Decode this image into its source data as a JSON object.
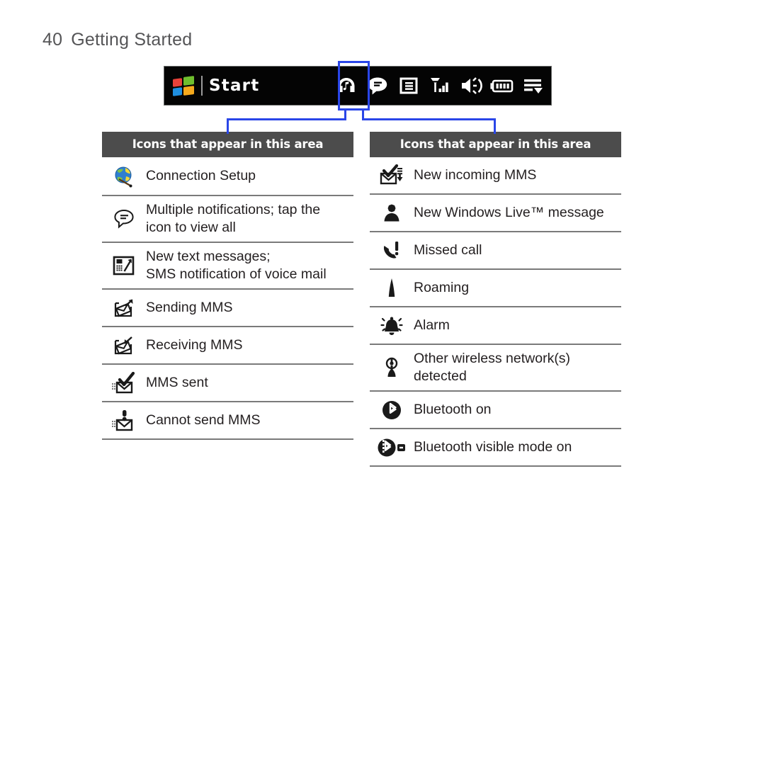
{
  "page": {
    "number": "40",
    "section_title": "Getting Started"
  },
  "taskbar": {
    "start_label": "Start",
    "logo_icon": "windows-logo-icon",
    "icons": [
      {
        "name": "headphones-music-icon",
        "label": "Music / headset"
      },
      {
        "name": "notification-bubble-icon",
        "label": "Multiple notifications",
        "highlighted": true
      },
      {
        "name": "message-list-icon",
        "label": "Messages"
      },
      {
        "name": "signal-strength-icon",
        "label": "Signal strength"
      },
      {
        "name": "speaker-volume-icon",
        "label": "Volume"
      },
      {
        "name": "battery-icon",
        "label": "Battery"
      },
      {
        "name": "menu-arrow-icon",
        "label": "More"
      }
    ]
  },
  "highlight": {
    "accent_color": "#2a46e8",
    "target_icon": "notification-bubble-icon"
  },
  "tables": [
    {
      "id": "left",
      "header": "Icons that appear in this area",
      "rows": [
        {
          "icon": "globe-connection-setup-icon",
          "label": "Connection Setup"
        },
        {
          "icon": "notification-bubble-icon",
          "label": "Multiple notifications; tap the icon to view all"
        },
        {
          "icon": "new-text-message-icon",
          "label": "New text messages;\nSMS notification of voice mail"
        },
        {
          "icon": "sending-mms-icon",
          "label": "Sending MMS"
        },
        {
          "icon": "receiving-mms-icon",
          "label": "Receiving MMS"
        },
        {
          "icon": "mms-sent-icon",
          "label": "MMS sent"
        },
        {
          "icon": "cannot-send-mms-icon",
          "label": "Cannot send MMS"
        }
      ]
    },
    {
      "id": "right",
      "header": "Icons that appear in this area",
      "rows": [
        {
          "icon": "new-incoming-mms-icon",
          "label": "New incoming MMS"
        },
        {
          "icon": "windows-live-message-icon",
          "label": "New Windows Live™ message"
        },
        {
          "icon": "missed-call-icon",
          "label": "Missed call"
        },
        {
          "icon": "roaming-icon",
          "label": "Roaming"
        },
        {
          "icon": "alarm-bell-icon",
          "label": "Alarm"
        },
        {
          "icon": "wireless-network-icon",
          "label": "Other wireless network(s)\ndetected"
        },
        {
          "icon": "bluetooth-on-icon",
          "label": "Bluetooth on"
        },
        {
          "icon": "bluetooth-visible-icon",
          "label": "Bluetooth visible mode on"
        }
      ]
    }
  ],
  "colors": {
    "header_bar": "#4c4c4c",
    "taskbar_bg": "#040404",
    "rule": "#7a7a7a",
    "accent": "#2a46e8",
    "text": "#231f20",
    "page_header_text": "#555557"
  }
}
